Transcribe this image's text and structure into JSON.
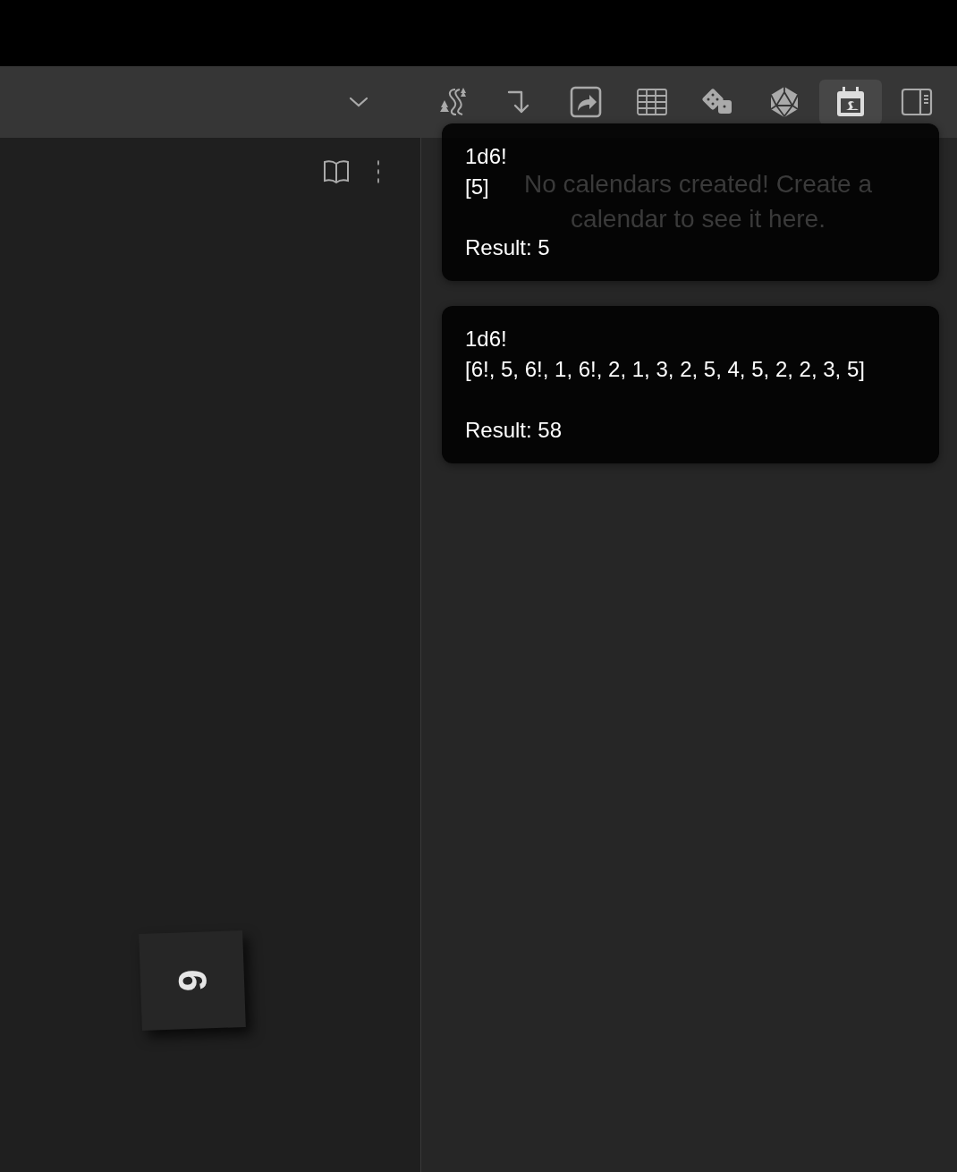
{
  "toolbar": {
    "items": [
      {
        "kind": "chevron",
        "selected": false
      },
      {
        "kind": "map",
        "selected": false
      },
      {
        "kind": "arrow",
        "selected": false
      },
      {
        "kind": "share",
        "selected": false
      },
      {
        "kind": "table",
        "selected": false
      },
      {
        "kind": "dice",
        "selected": false
      },
      {
        "kind": "d20",
        "selected": false
      },
      {
        "kind": "calendar",
        "selected": true
      },
      {
        "kind": "sidebar",
        "selected": false
      }
    ]
  },
  "left_pane": {
    "die_face": "6"
  },
  "right_pane": {
    "empty_message": [
      "No calendars created! Create a",
      "calendar to see it here."
    ]
  },
  "notifications": [
    {
      "formula": "1d6!",
      "rolls": "[5]",
      "result": "Result: 5"
    },
    {
      "formula": "1d6!",
      "rolls": "[6!, 5, 6!, 1, 6!, 2, 1, 3, 2, 5, 4, 5, 2, 2, 3, 5]",
      "result": "Result: 58"
    }
  ]
}
